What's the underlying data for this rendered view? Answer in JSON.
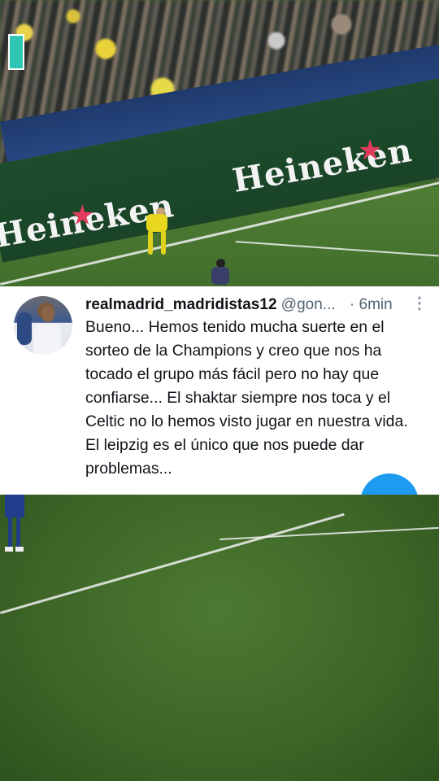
{
  "background": {
    "ads": [
      "Heineken",
      "Heineken"
    ]
  },
  "tweet": {
    "display_name": "realmadrid_madridistas12",
    "handle": "@gon...",
    "time": "6min",
    "separator": "·",
    "more_icon": "more-vertical-icon",
    "text": "Bueno... Hemos tenido mucha suerte en el sorteo de la Champions y creo que nos ha tocado el grupo más fácil pero no hay que confiarse... El shaktar siempre nos toca y el Celtic no lo hemos visto jugar en nuestra vida.\nEl leipzig es el único que nos puede dar problemas...",
    "fab_color": "#1d9bf0"
  }
}
